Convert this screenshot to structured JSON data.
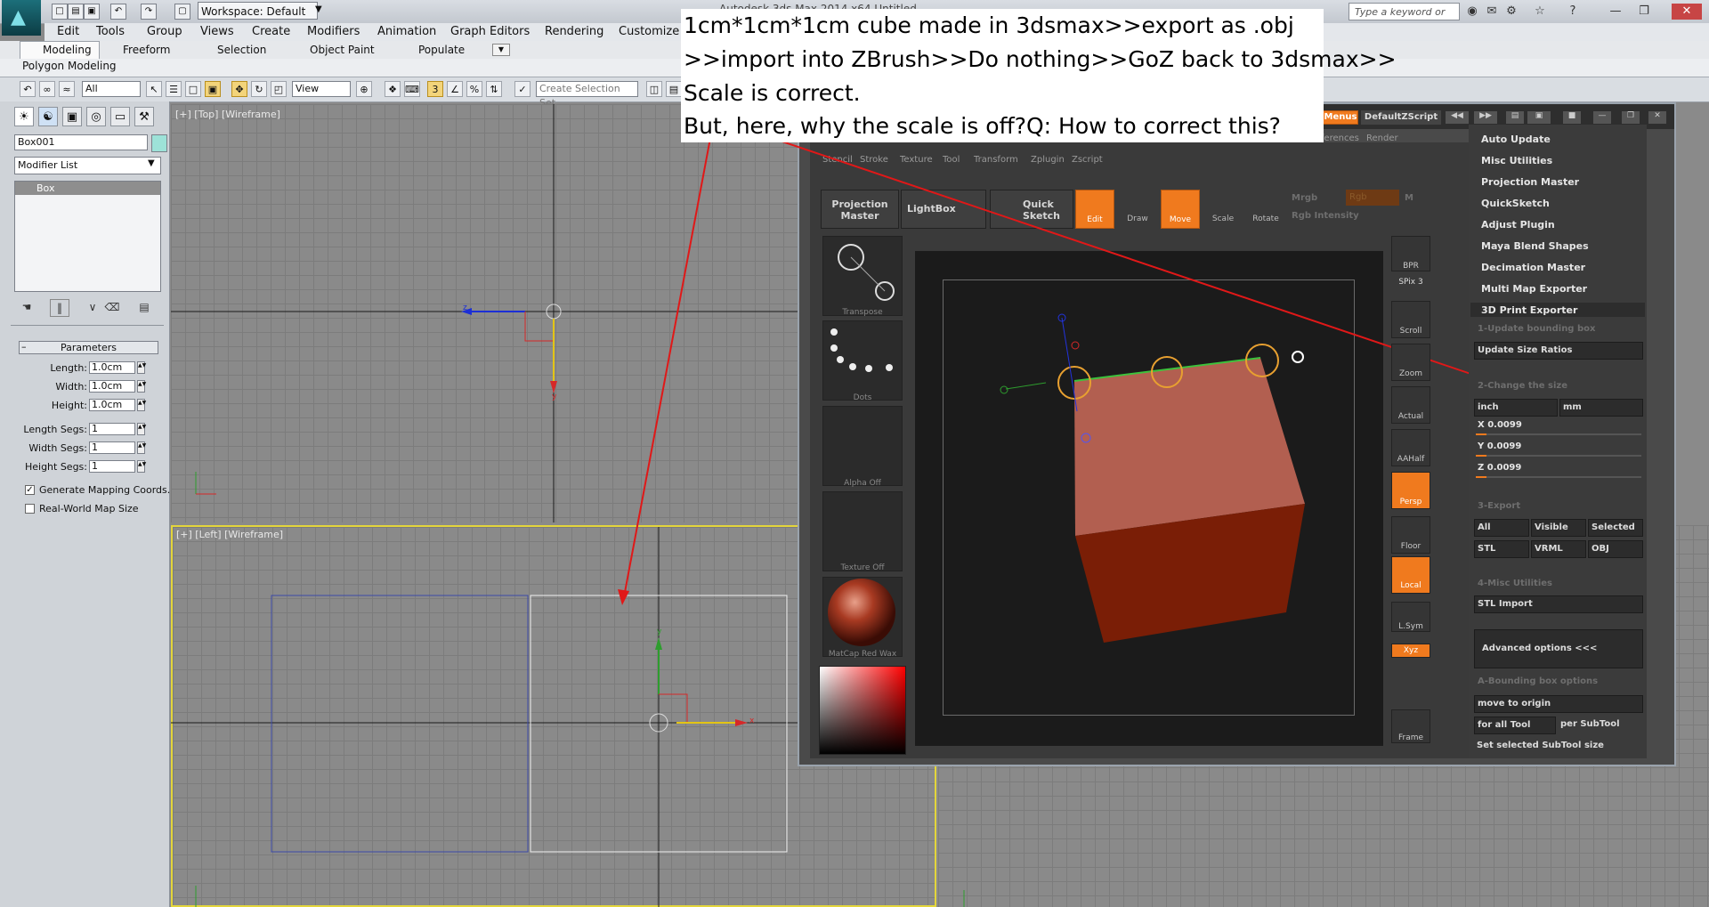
{
  "app": {
    "workspace": "Workspace: Default",
    "doc_title": "Autodesk 3ds Max  2014 x64    Untitled",
    "search_placeholder": "Type a keyword or phrase"
  },
  "menubar": [
    "Edit",
    "Tools",
    "Group",
    "Views",
    "Create",
    "Modifiers",
    "Animation",
    "Graph Editors",
    "Rendering",
    "Customize"
  ],
  "ribbon_tabs": [
    "Modeling",
    "Freeform",
    "Selection",
    "Object Paint",
    "Populate"
  ],
  "ribbon_sub": "Polygon Modeling",
  "toolbar": {
    "filter_value": "All",
    "refcoord_value": "View",
    "selection_set_placeholder": "Create Selection Set"
  },
  "command_panel": {
    "object_name": "Box001",
    "modifier_list": "Modifier List",
    "stack_item": "Box",
    "rollout": "Parameters",
    "params": [
      {
        "label": "Length:",
        "value": "1.0cm"
      },
      {
        "label": "Width:",
        "value": "1.0cm"
      },
      {
        "label": "Height:",
        "value": "1.0cm"
      },
      {
        "label": "Length Segs:",
        "value": "1"
      },
      {
        "label": "Width Segs:",
        "value": "1"
      },
      {
        "label": "Height Segs:",
        "value": "1"
      }
    ],
    "gen_mapping": "Generate Mapping Coords.",
    "real_world": "Real-World Map Size"
  },
  "viewports": {
    "top": "[+] [Top] [Wireframe]",
    "left": "[+] [Left] [Wireframe]"
  },
  "note": [
    "1cm*1cm*1cm cube made in 3dsmax>>export as .obj",
    ">>import into ZBrush>>Do nothing>>GoZ back to 3dsmax>>",
    "Scale is correct.",
    "But, here, why the scale is off?Q: How to correct this?"
  ],
  "zbrush": {
    "menus_label": "Menus",
    "script_label": "DefaultZScript",
    "top_menu": [
      "Stencil",
      "Stroke",
      "Texture",
      "Tool",
      "Transform",
      "Zplugin",
      "Zscript"
    ],
    "top_menu_right": [
      "Preferences",
      "Render"
    ],
    "proj_master": "Projection Master",
    "lightbox": "LightBox",
    "quick_sketch": "Quick Sketch",
    "modes": [
      "Edit",
      "Draw",
      "Move",
      "Scale",
      "Rotate"
    ],
    "mrgb": "Mrgb",
    "rgb": "Rgb",
    "m": "M",
    "rgb_intensity": "Rgb Intensity",
    "thumbs": [
      "Transpose",
      "Dots",
      "Alpha Off",
      "Texture Off",
      "MatCap Red Wax"
    ],
    "side_tools": [
      "BPR",
      "SPix 3",
      "Scroll",
      "Zoom",
      "Actual",
      "AAHalf",
      "Persp",
      "Floor",
      "Local",
      "L.Sym",
      "Xyz",
      "Frame"
    ],
    "plugin_menu": [
      "Auto Update",
      "Misc Utilities",
      "Projection Master",
      "QuickSketch",
      "Adjust Plugin",
      "Maya Blend Shapes",
      "Decimation Master",
      "Multi Map Exporter"
    ],
    "exporter_title": "3D Print Exporter",
    "step1": "1-Update bounding box",
    "update_ratios": "Update Size Ratios",
    "step2": "2-Change the size",
    "unit_inch": "inch",
    "unit_mm": "mm",
    "size_x": "X 0.0099",
    "size_y": "Y 0.0099",
    "size_z": "Z 0.0099",
    "step3": "3-Export",
    "export_opts": [
      "All",
      "Visible",
      "Selected"
    ],
    "formats": [
      "STL",
      "VRML",
      "OBJ"
    ],
    "step4": "4-Misc Utilities",
    "stl_import": "STL Import",
    "advanced": "Advanced options <<<",
    "bbox_opts": "A-Bounding box options",
    "move_origin": "move to origin",
    "for_all": "for all Tool",
    "per_subtool": "per SubTool",
    "set_selected": "Set selected SubTool size"
  }
}
